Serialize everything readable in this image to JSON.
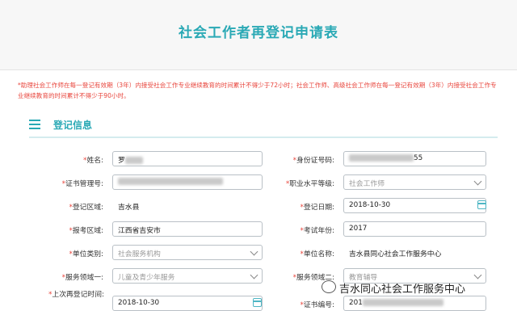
{
  "page_title": "社会工作者再登记申请表",
  "notice": "*助理社会工作师在每一登记有效期（3年）内接受社会工作专业继续教育的时间累计不得少于72小时；社会工作师、高级社会工作师在每一登记有效期（3年）内接受社会工作专业继续教育的时间累计不得少于90小时。",
  "section_title": "登记信息",
  "fields": {
    "name": {
      "label": "姓名:",
      "value": "罗"
    },
    "id_number": {
      "label": "身份证号码:",
      "value": "55"
    },
    "cert_mgmt_no": {
      "label": "证书管理号:",
      "value": ""
    },
    "level": {
      "label": "职业水平等级:",
      "value": "社会工作师"
    },
    "region": {
      "label": "登记区域:",
      "value": "吉水县"
    },
    "reg_date": {
      "label": "登记日期:",
      "value": "2018-10-30"
    },
    "exam_region": {
      "label": "报考区域:",
      "value": "江西省吉安市"
    },
    "exam_year": {
      "label": "考试年份:",
      "value": "2017"
    },
    "org_type": {
      "label": "单位类别:",
      "value": "社会服务机构"
    },
    "org_name": {
      "label": "单位名称:",
      "value": "吉水县同心社会工作服务中心"
    },
    "domain1": {
      "label": "服务领域一:",
      "value": "儿童及青少年服务"
    },
    "domain2": {
      "label": "服务领域二:",
      "value": "教育辅导"
    },
    "last_reg_time": {
      "label": "上次再登记时间:",
      "value": "2018-10-30"
    },
    "cert_no": {
      "label": "证书编号:",
      "value": "201"
    }
  },
  "watermark": "吉水同心社会工作服务中心",
  "colors": {
    "accent": "#2aa9b5",
    "required": "#e8453c"
  }
}
